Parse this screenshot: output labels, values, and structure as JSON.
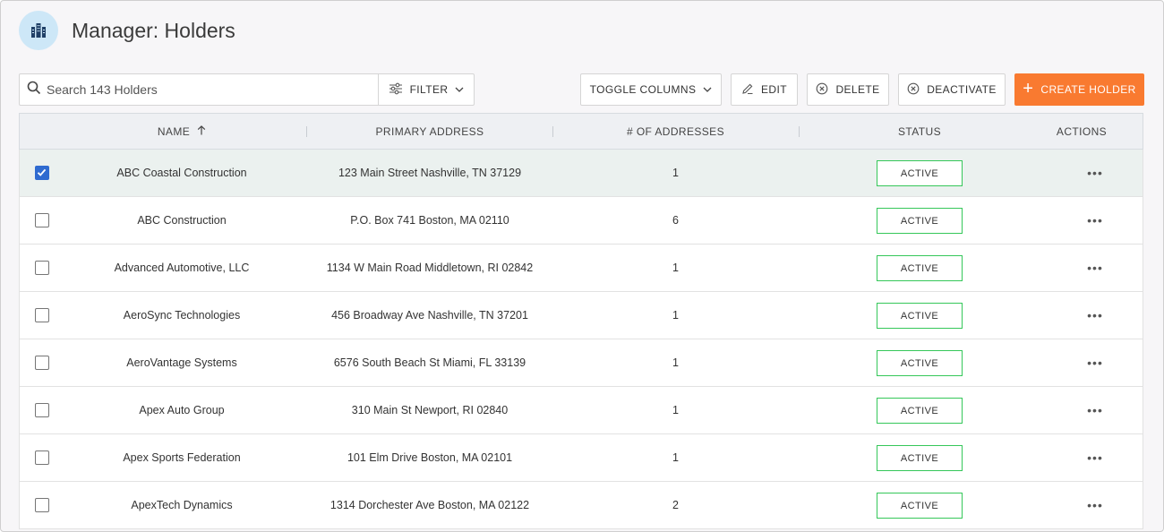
{
  "header": {
    "title": "Manager: Holders",
    "logo_icon": "building-icon",
    "logo_color": "#cde7f7"
  },
  "toolbar": {
    "search_placeholder": "Search 143 Holders",
    "filter_label": "FILTER",
    "toggle_columns_label": "TOGGLE COLUMNS",
    "edit_label": "EDIT",
    "delete_label": "DELETE",
    "deactivate_label": "DEACTIVATE",
    "create_label": "CREATE HOLDER",
    "create_color": "#f97a30"
  },
  "table": {
    "columns": {
      "name": "NAME",
      "primary_address": "PRIMARY ADDRESS",
      "num_addresses": "# OF ADDRESSES",
      "status": "STATUS",
      "actions": "ACTIONS"
    },
    "sort": {
      "column": "name",
      "direction": "ascending"
    },
    "rows": [
      {
        "checked": true,
        "name": "ABC Coastal Construction",
        "address": "123 Main Street Nashville, TN 37129",
        "count": "1",
        "status": "ACTIVE",
        "actions": "•••"
      },
      {
        "checked": false,
        "name": "ABC Construction",
        "address": "P.O. Box 741 Boston, MA 02110",
        "count": "6",
        "status": "ACTIVE",
        "actions": "•••"
      },
      {
        "checked": false,
        "name": "Advanced Automotive, LLC",
        "address": "1134 W Main Road Middletown, RI 02842",
        "count": "1",
        "status": "ACTIVE",
        "actions": "•••"
      },
      {
        "checked": false,
        "name": "AeroSync Technologies",
        "address": "456 Broadway Ave Nashville, TN 37201",
        "count": "1",
        "status": "ACTIVE",
        "actions": "•••"
      },
      {
        "checked": false,
        "name": "AeroVantage Systems",
        "address": "6576 South Beach St Miami, FL 33139",
        "count": "1",
        "status": "ACTIVE",
        "actions": "•••"
      },
      {
        "checked": false,
        "name": "Apex Auto Group",
        "address": "310 Main St Newport, RI 02840",
        "count": "1",
        "status": "ACTIVE",
        "actions": "•••"
      },
      {
        "checked": false,
        "name": "Apex Sports Federation",
        "address": "101 Elm Drive Boston, MA 02101",
        "count": "1",
        "status": "ACTIVE",
        "actions": "•••"
      },
      {
        "checked": false,
        "name": "ApexTech Dynamics",
        "address": "1314 Dorchester Ave Boston, MA 02122",
        "count": "2",
        "status": "ACTIVE",
        "actions": "•••"
      }
    ],
    "status_color": "#35c759",
    "selected_row_color": "#ebf1ef",
    "checkbox_color": "#2f6bd0"
  }
}
